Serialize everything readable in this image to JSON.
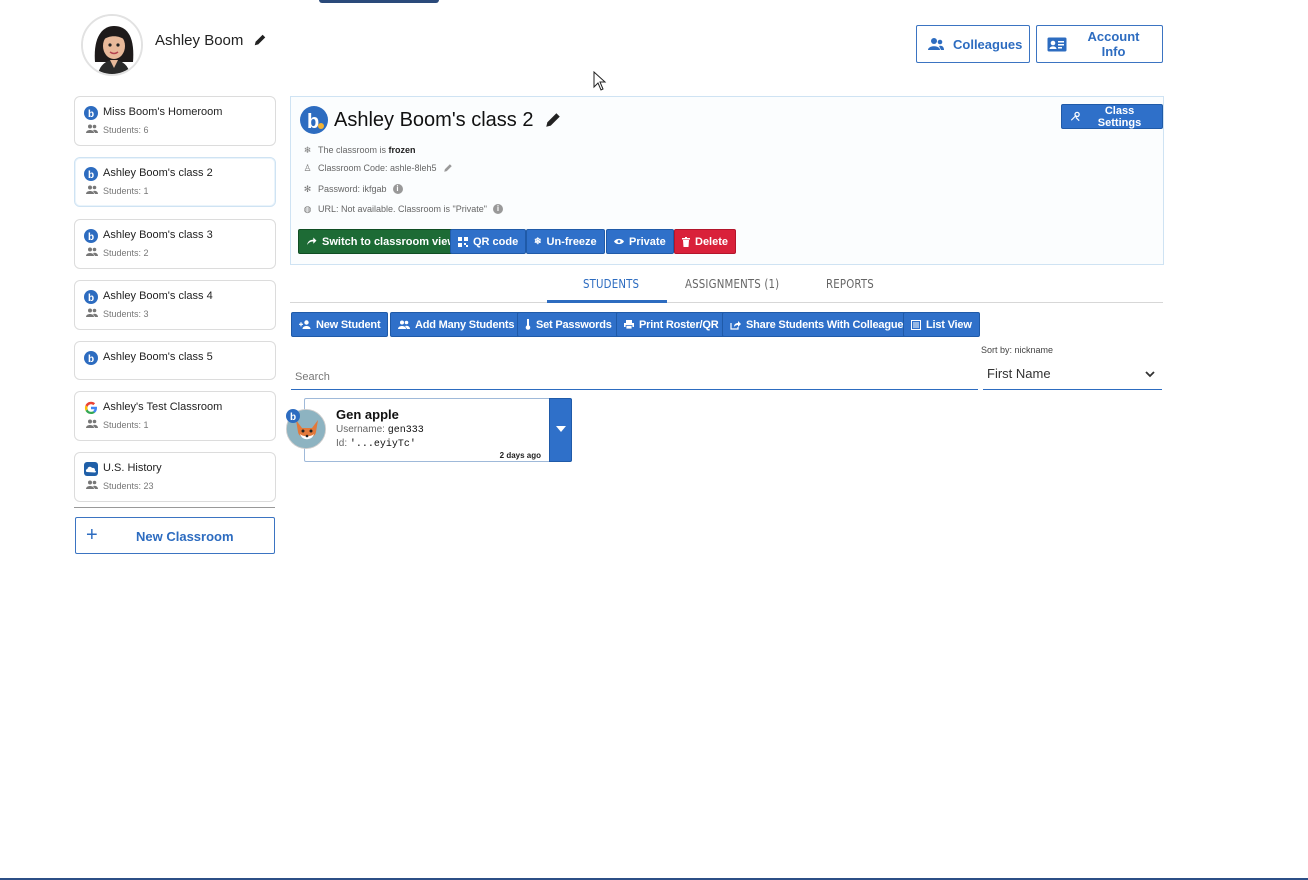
{
  "profile": {
    "name": "Ashley Boom"
  },
  "header_buttons": {
    "colleagues": "Colleagues",
    "account_info": "Account Info"
  },
  "sidebar": {
    "classes": [
      {
        "name": "Miss Boom's Homeroom",
        "students": "Students: 6",
        "icon": "boom-b-icon"
      },
      {
        "name": "Ashley Boom's class 2",
        "students": "Students: 1",
        "icon": "boom-b-icon"
      },
      {
        "name": "Ashley Boom's class 3",
        "students": "Students: 2",
        "icon": "boom-b-icon"
      },
      {
        "name": "Ashley Boom's class 4",
        "students": "Students: 3",
        "icon": "boom-b-icon"
      },
      {
        "name": "Ashley Boom's class 5",
        "students": "",
        "icon": "boom-b-icon"
      },
      {
        "name": "Ashley's Test Classroom",
        "students": "Students: 1",
        "icon": "google-icon"
      },
      {
        "name": "U.S. History",
        "students": "Students: 23",
        "icon": "classlink-icon"
      }
    ],
    "new_classroom": "New Classroom"
  },
  "class_panel": {
    "title": "Ashley Boom's class 2",
    "class_settings": "Class Settings",
    "frozen_prefix": "The classroom is",
    "frozen_state": "frozen",
    "classroom_code": "Classroom Code: ashle-8leh5",
    "password": "Password: ikfgab",
    "url": "URL: Not available. Classroom is \"Private\"",
    "actions": {
      "switch": "Switch to classroom view",
      "qr": "QR code",
      "unfreeze": "Un-freeze",
      "private": "Private",
      "delete": "Delete"
    }
  },
  "tabs": {
    "students": "STUDENTS",
    "assignments": "ASSIGNMENTS (1)",
    "reports": "REPORTS"
  },
  "toolbar": {
    "new_student": "New Student",
    "add_many": "Add Many Students",
    "set_passwords": "Set Passwords",
    "print_roster": "Print Roster/QR",
    "share": "Share Students With Colleague",
    "list_view": "List View"
  },
  "search": {
    "placeholder": "Search"
  },
  "sort": {
    "label": "Sort by: nickname",
    "value": "First Name"
  },
  "students": [
    {
      "name": "Gen apple",
      "username_label": "Username:",
      "username": "gen333",
      "id_label": "Id:",
      "id": "'...eyiyTc'",
      "time": "2 days ago"
    }
  ],
  "colors": {
    "primary": "#2f70c9",
    "green": "#1d6b35",
    "red": "#d9213a"
  }
}
